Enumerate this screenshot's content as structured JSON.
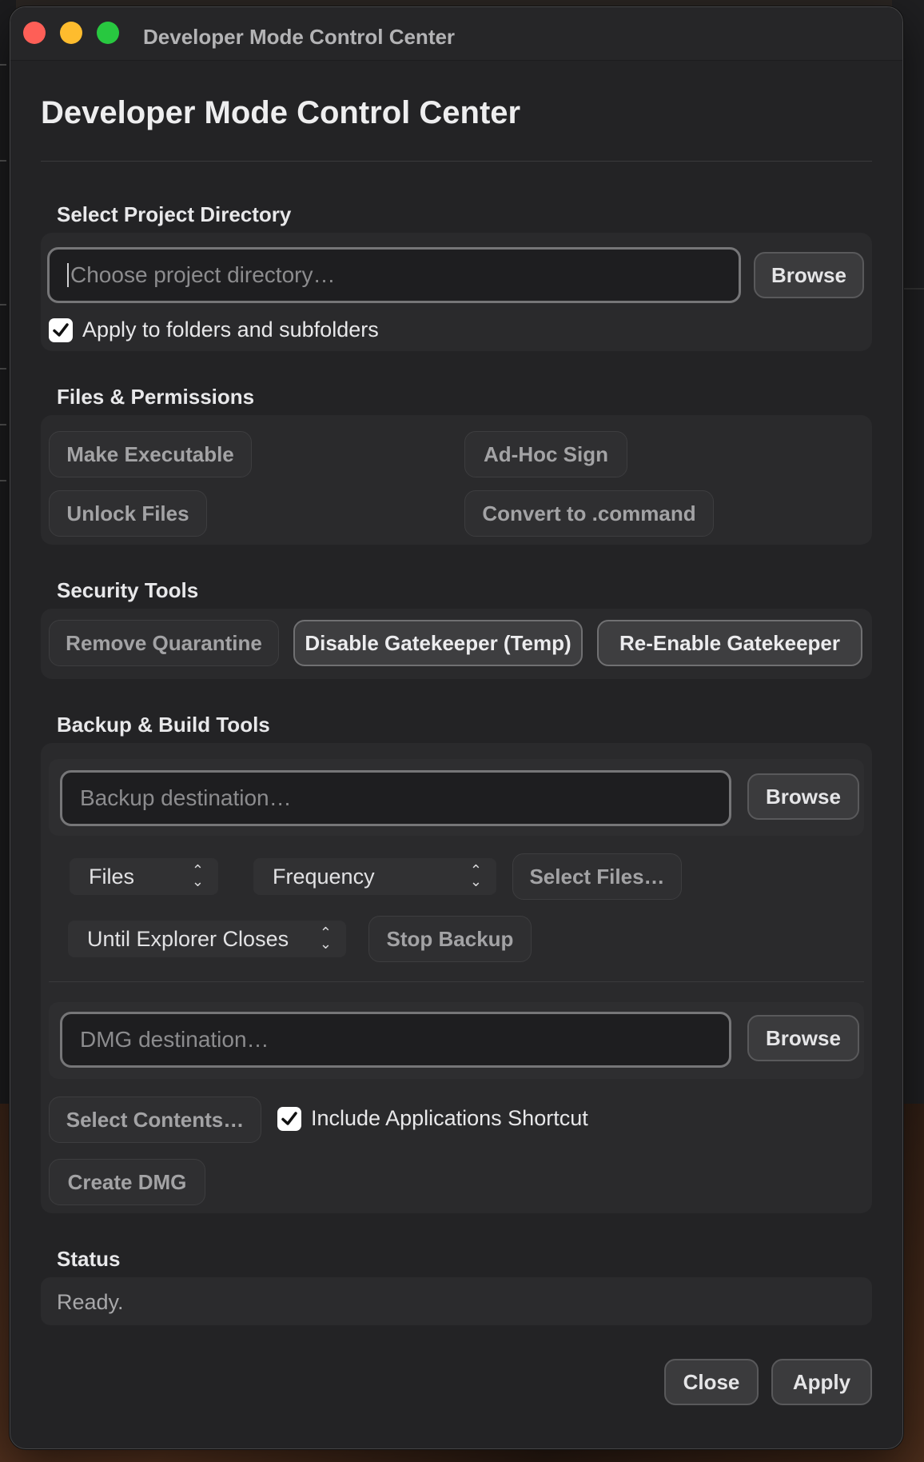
{
  "window": {
    "title": "Developer Mode Control Center"
  },
  "heading": "Developer Mode Control Center",
  "project": {
    "section_title": "Select Project Directory",
    "placeholder": "Choose project directory…",
    "browse_label": "Browse",
    "apply_subfolders_label": "Apply to folders and subfolders",
    "apply_subfolders_checked": true
  },
  "files_permissions": {
    "section_title": "Files & Permissions",
    "make_executable": "Make Executable",
    "adhoc_sign": "Ad-Hoc Sign",
    "unlock_files": "Unlock Files",
    "convert_command": "Convert to .command"
  },
  "security": {
    "section_title": "Security Tools",
    "remove_quarantine": "Remove Quarantine",
    "disable_gatekeeper": "Disable Gatekeeper (Temp)",
    "reenable_gatekeeper": "Re-Enable Gatekeeper"
  },
  "backup_build": {
    "section_title": "Backup & Build Tools",
    "backup_placeholder": "Backup destination…",
    "backup_browse": "Browse",
    "type_select": "Files",
    "frequency_select": "Frequency",
    "select_files": "Select Files…",
    "duration_select": "Until Explorer Closes",
    "stop_backup": "Stop Backup",
    "dmg_placeholder": "DMG destination…",
    "dmg_browse": "Browse",
    "select_contents": "Select Contents…",
    "include_apps_label": "Include Applications Shortcut",
    "include_apps_checked": true,
    "create_dmg": "Create DMG"
  },
  "status": {
    "section_title": "Status",
    "text": "Ready."
  },
  "footer": {
    "close": "Close",
    "apply": "Apply"
  },
  "colors": {
    "window_bg": "#232325",
    "panel_bg": "#2a2a2c",
    "close_red": "#fe5f57",
    "minimize_yellow": "#febc2e",
    "zoom_green": "#28c840"
  },
  "icons": {
    "check": "checkmark-icon",
    "chevron": "chevron-updown-icon"
  }
}
